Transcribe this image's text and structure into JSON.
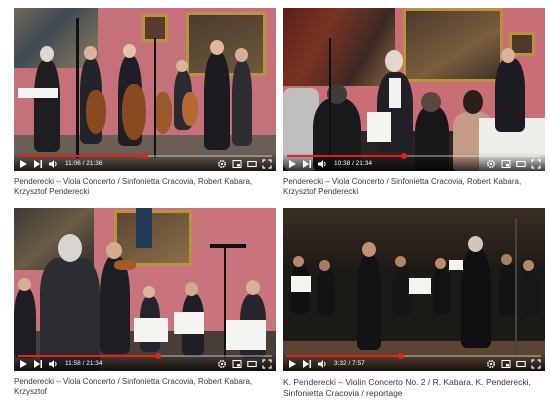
{
  "videos": [
    {
      "title": "Penderecki – Viola Concerto / Sinfonietta Cracovia, Robert Kabara, Krzysztof Penderecki",
      "time": "11:06 / 21:36",
      "progress": 0.5
    },
    {
      "title": "Penderecki – Viola Concerto / Sinfonietta Cracovia, Robert Kabara, Krzysztof Penderecki",
      "time": "10:38 / 21:34",
      "progress": 0.46
    },
    {
      "title": "Penderecki – Viola Concerto / Sinfonietta Cracovia, Robert Kabara, Krzysztof",
      "time": "11:58 / 21:34",
      "progress": 0.55
    },
    {
      "title": "K. Penderecki – Violin Concerto No. 2 / R. Kabara, K. Penderecki, Sinfonietta Cracovia / reportage",
      "time": "3:32 / 7:57",
      "progress": 0.45
    }
  ],
  "colors": {
    "progress": "#e62117",
    "wall_pink": "#c9737c",
    "stage_dark": "#1c1a17"
  },
  "icons": [
    "play-icon",
    "next-icon",
    "volume-icon",
    "settings-icon",
    "miniplayer-icon",
    "theater-icon",
    "fullscreen-icon"
  ]
}
